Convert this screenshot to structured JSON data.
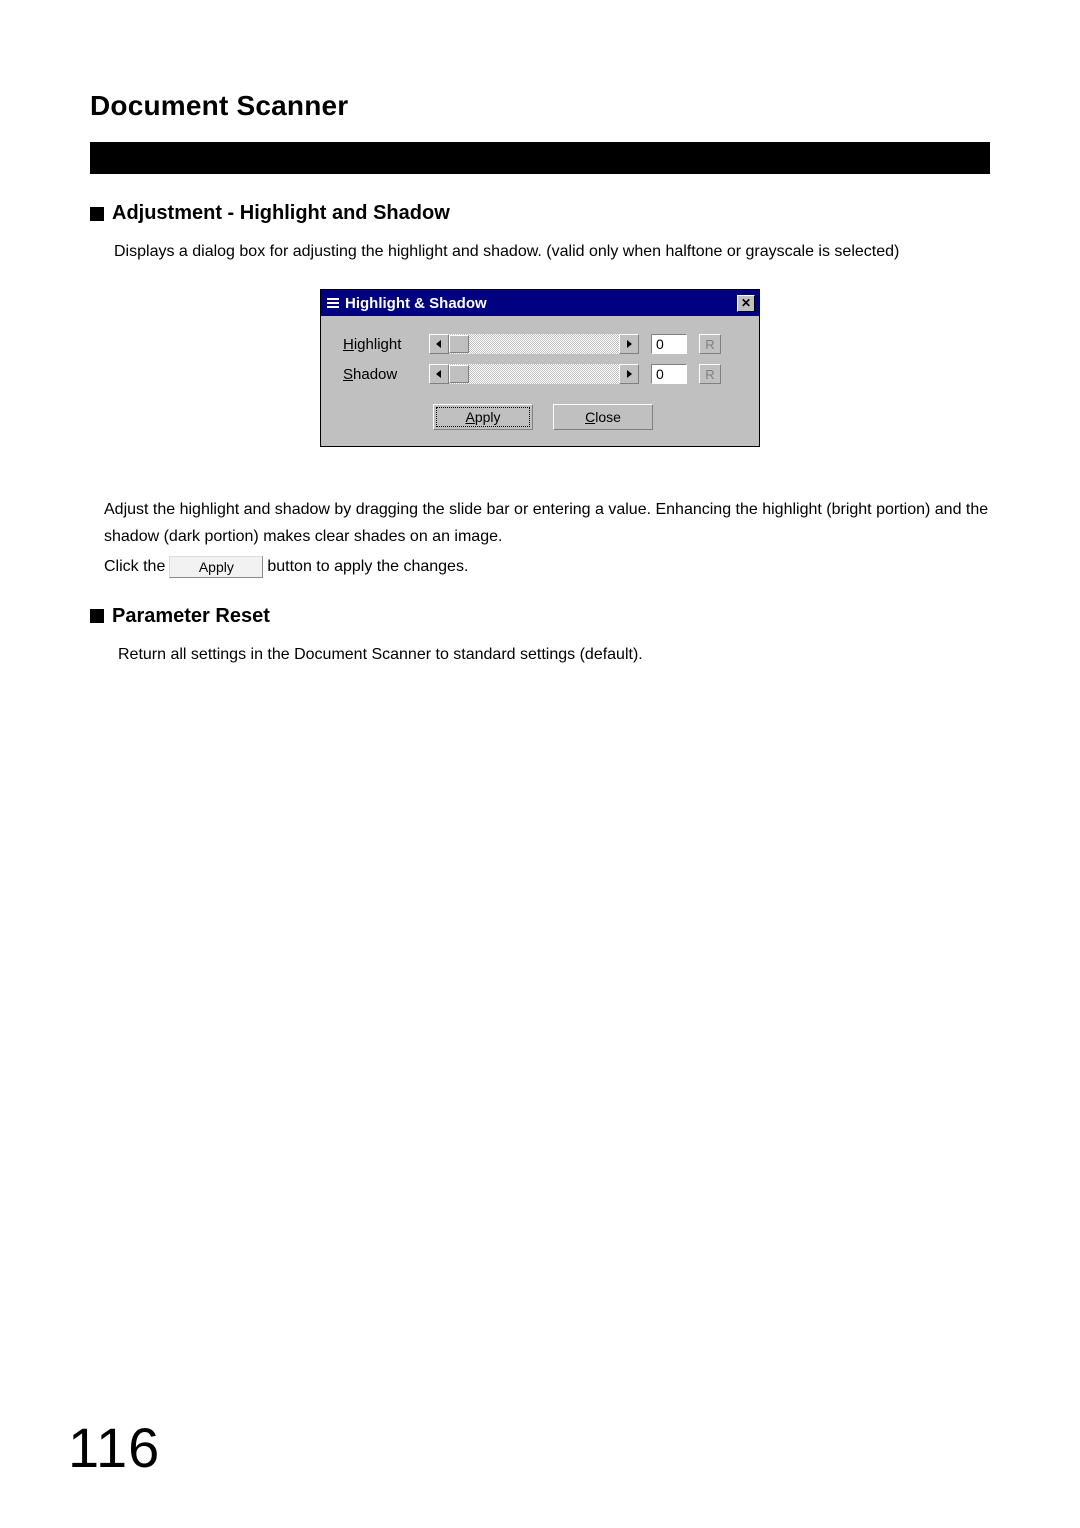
{
  "page": {
    "title": "Document Scanner",
    "number": "116"
  },
  "section1": {
    "heading": "Adjustment - Highlight and Shadow",
    "intro": "Displays a dialog box for adjusting the highlight and shadow.  (valid only when halftone or grayscale is selected)",
    "para1": "Adjust the highlight and shadow by dragging the slide bar or entering a value.  Enhancing the highlight (bright portion) and the shadow (dark portion) makes clear shades on an image.",
    "para2_pre": "Click the ",
    "para2_btn": "Apply",
    "para2_post": " button to apply the changes."
  },
  "section2": {
    "heading": "Parameter Reset",
    "body": "Return all settings in the Document Scanner to standard settings (default)."
  },
  "dialog": {
    "title": "Highlight & Shadow",
    "close_glyph": "✕",
    "highlight": {
      "label_u": "H",
      "label_rest": "ighlight",
      "value": "0",
      "reset": "R"
    },
    "shadow": {
      "label_u": "S",
      "label_rest": "hadow",
      "value": "0",
      "reset": "R"
    },
    "apply": {
      "u": "A",
      "rest": "pply"
    },
    "close": {
      "u": "C",
      "rest": "lose"
    }
  }
}
